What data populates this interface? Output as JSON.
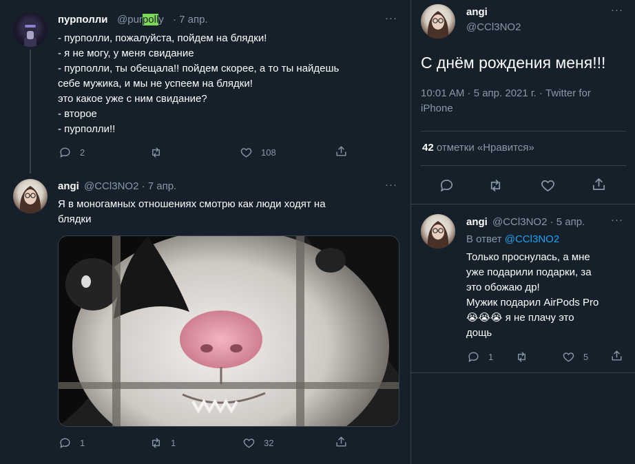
{
  "left": {
    "tweet1": {
      "name": "пурполли",
      "handle_a": "@pur",
      "handle_b": "poll",
      "handle_c": "y",
      "dot_date": "· 7 апр.",
      "more": "···",
      "lines": [
        "- пурполли, пожалуйста, пойдем на блядки!",
        "- я не могу, у меня свидание",
        "- пурполли, ты обещала!! пойдем скорее, а то ты найдешь",
        "себе мужика, и мы не успеем на блядки!",
        "это какое уже с ним свидание?",
        "- второе",
        "- пурполли!!"
      ],
      "reply_count": "2",
      "retweet_count": "",
      "like_count": "108"
    },
    "tweet2": {
      "name": "angi",
      "handle_date": "@CCl3NO2 · 7 апр.",
      "more": "···",
      "lines": [
        "Я в моногамных отношениях смотрю как люди ходят на",
        "блядки"
      ],
      "reply_count": "1",
      "retweet_count": "1",
      "like_count": "32"
    }
  },
  "right": {
    "main": {
      "name": "angi",
      "handle": "@CCl3NO2",
      "more": "···",
      "text": "С днём рождения меня!!!",
      "timestamp_line1": "10:01 AM · 5 апр. 2021 г. · Twitter for",
      "timestamp_line2": "iPhone",
      "likes_number": "42",
      "likes_label": "отметки «Нравится»"
    },
    "reply": {
      "name": "angi",
      "handle_date": "@CCl3NO2 · 5 апр.",
      "more": "···",
      "reply_to_prefix": "В ответ",
      "reply_to_handle": "@CCl3NO2",
      "lines": [
        "Только проснулась, а мне",
        "уже подарили подарки, за",
        "это обожаю др!",
        "Мужик подарил AirPods Pro",
        "😭😭😭 я не плачу это",
        "дощь"
      ],
      "reply_count": "1",
      "retweet_count": "",
      "like_count": "5"
    }
  },
  "colors": {
    "background": "#15202b",
    "secondary_text": "#8899a6",
    "divider": "#38444d",
    "link": "#1da1f2",
    "handle_highlight": "#7ed957"
  },
  "icons": [
    "reply-icon",
    "retweet-icon",
    "like-icon",
    "share-icon",
    "more-icon"
  ]
}
